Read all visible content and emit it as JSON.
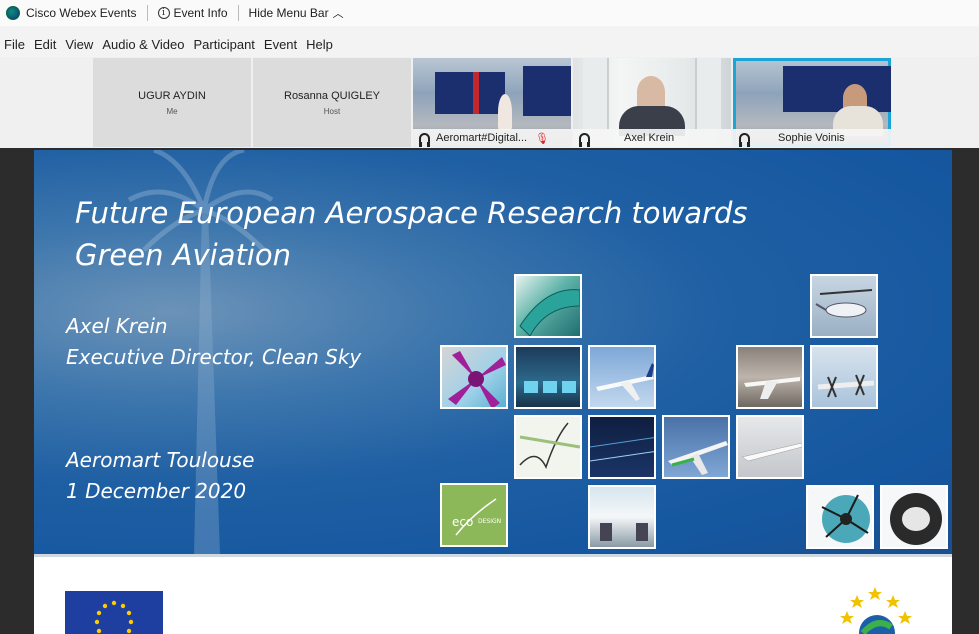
{
  "titlebar": {
    "app_name": "Cisco Webex Events",
    "event_info": "Event Info",
    "hide_menu": "Hide Menu Bar"
  },
  "menu": [
    "File",
    "Edit",
    "View",
    "Audio & Video",
    "Participant",
    "Event",
    "Help"
  ],
  "participants": [
    {
      "name": "UGUR AYDIN",
      "role": "Me"
    },
    {
      "name": "Rosanna QUIGLEY",
      "role": "Host"
    }
  ],
  "videos": [
    {
      "name": "Aeromart#Digital..."
    },
    {
      "name": "Axel Krein"
    },
    {
      "name": "Sophie Voinis"
    }
  ],
  "slide": {
    "title_line1": "Future European Aerospace Research towards",
    "title_line2": "Green Aviation",
    "presenter_line1": "Axel Krein",
    "presenter_line2": "Executive Director, Clean Sky",
    "event_line1": "Aeromart Toulouse",
    "event_line2": "1 December 2020",
    "eco_label": "eco",
    "eco_sub": "DESIGN"
  },
  "colors": {
    "selected_outline": "#1aa5d6",
    "slide_blue": "#1557a0",
    "eu_blue": "#1f3fa0",
    "eu_star": "#ffcc00"
  }
}
